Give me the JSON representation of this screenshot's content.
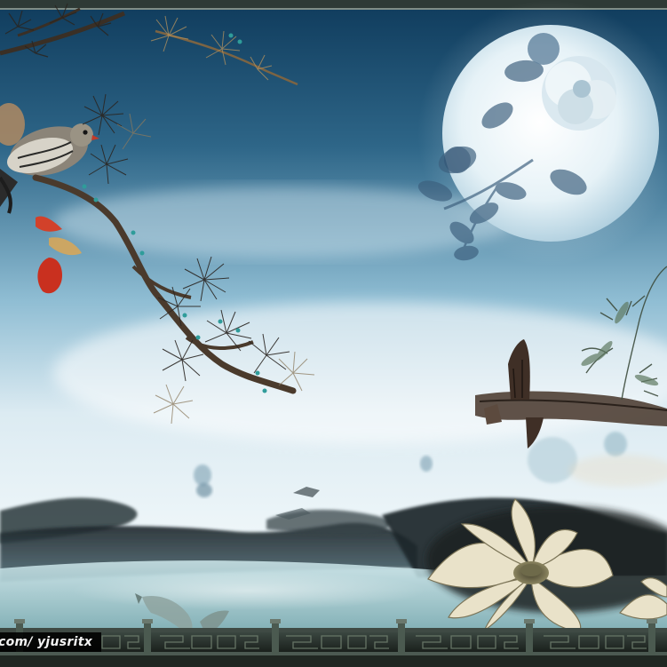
{
  "image": {
    "watermark_text": "com/ yjusritx"
  },
  "palette": {
    "sky_top": "#0f3b5c",
    "sky_mid": "#5f97b4",
    "sky_low": "#dcebf2",
    "mist": "#eef6f9",
    "ink_dark": "#1d2428",
    "moon": "#e9f4f8",
    "flower_blue": "#3d5f7e",
    "berry_red": "#c9301f",
    "lotus_cream": "#e9e2c9",
    "fence_dark": "#26302a"
  },
  "elements": [
    "moon-icon",
    "peony-icon",
    "pine-branch-icon",
    "bird-icon",
    "red-berry-icon",
    "rock-pier-icon",
    "bamboo-icon",
    "lotus-icon",
    "koi-fish-icon",
    "ink-mountains-icon",
    "fence-railing-icon"
  ]
}
